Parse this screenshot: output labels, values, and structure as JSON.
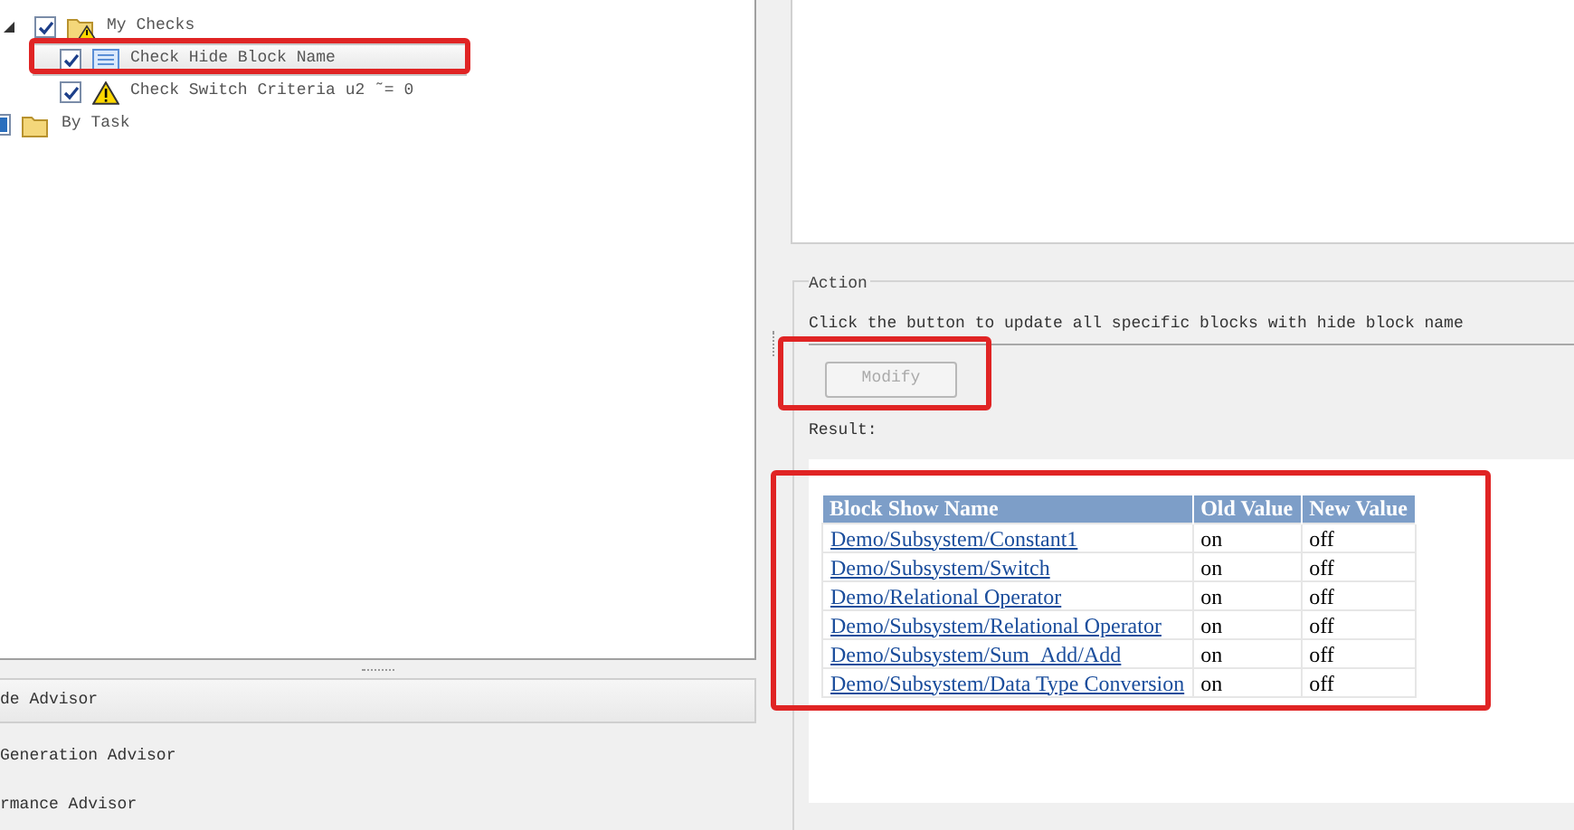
{
  "tree": [
    {
      "label": "My Checks",
      "kind": "warning-folder",
      "checked": true,
      "partial": false,
      "expanded": true,
      "selected": false,
      "children": [
        {
          "label": "Check Hide Block Name",
          "kind": "check",
          "checked": true,
          "partial": false,
          "selected": true
        },
        {
          "label": "Check Switch Criteria u2 ˜= 0",
          "kind": "warning",
          "checked": true,
          "partial": false,
          "selected": false
        }
      ]
    },
    {
      "label": "By Task",
      "kind": "folder",
      "partial": true,
      "selected": false
    }
  ],
  "advisors": [
    {
      "label": "de Advisor",
      "selected": true
    },
    {
      "label": "Generation Advisor",
      "selected": false
    },
    {
      "label": "rmance Advisor",
      "selected": false
    }
  ],
  "action": {
    "title": "Action",
    "description": "Click the button to update all specific blocks with hide block name",
    "button": {
      "label": "Modify",
      "disabled": true
    },
    "result_label": "Result:"
  },
  "table": {
    "columns": [
      "Block Show Name",
      "Old Value",
      "New Value"
    ],
    "rows": [
      [
        "Demo/Subsystem/Constant1",
        "on",
        "off"
      ],
      [
        "Demo/Subsystem/Switch",
        "on",
        "off"
      ],
      [
        "Demo/Relational Operator",
        "on",
        "off"
      ],
      [
        "Demo/Subsystem/Relational Operator",
        "on",
        "off"
      ],
      [
        "Demo/Subsystem/Sum_Add/Add",
        "on",
        "off"
      ],
      [
        "Demo/Subsystem/Data Type Conversion",
        "on",
        "off"
      ]
    ]
  }
}
